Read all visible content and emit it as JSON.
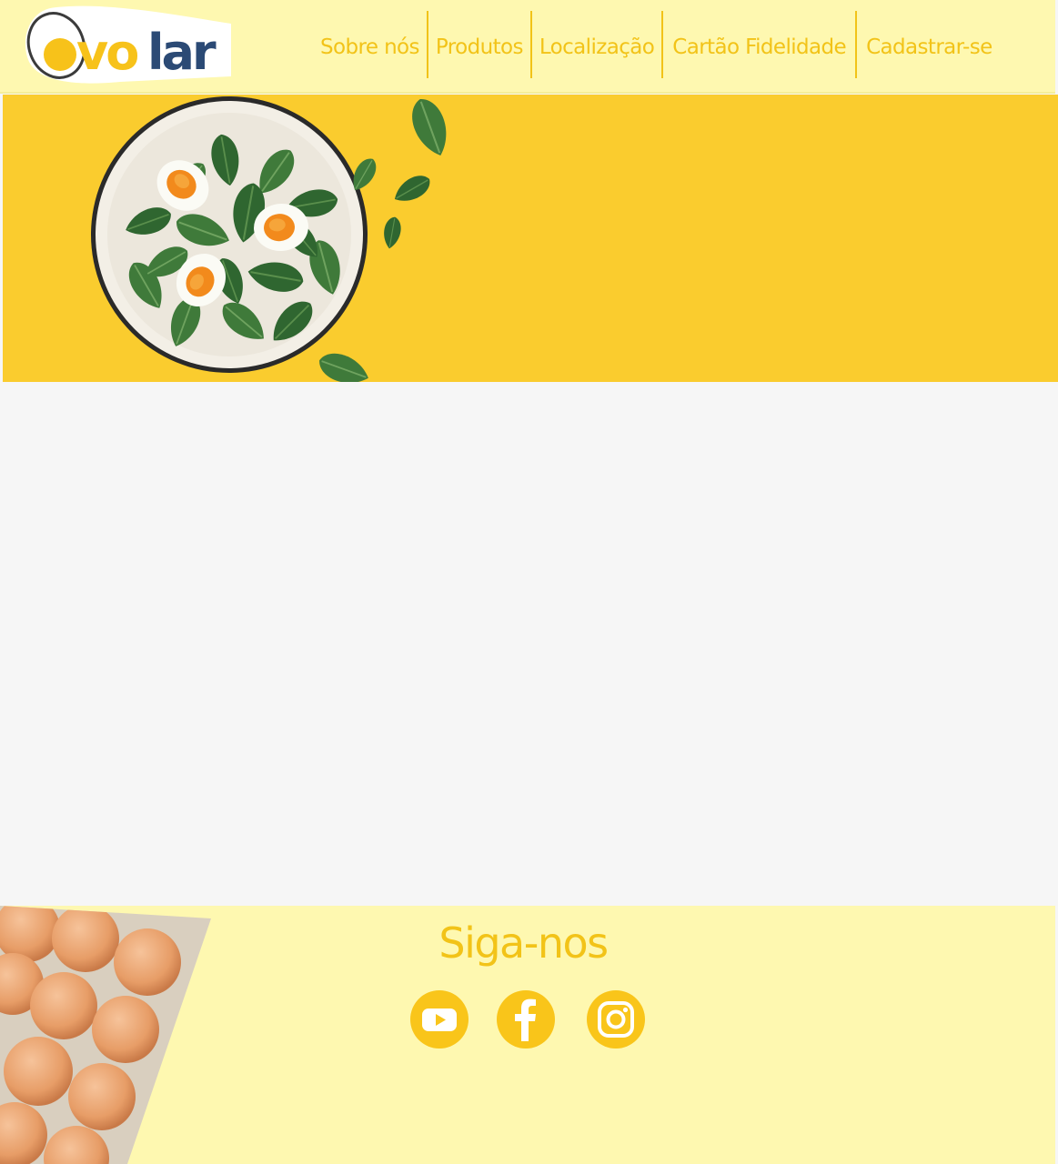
{
  "brand": {
    "logo_text": "ovolar",
    "colors": {
      "yellow": "#facc2e",
      "nav_text": "#f2c318",
      "pale_yellow": "#fef8b0",
      "logo_navy": "#2b4a75"
    }
  },
  "nav": {
    "items": [
      {
        "label": "Sobre nós"
      },
      {
        "label": "Produtos"
      },
      {
        "label": "Localização"
      },
      {
        "label": "Cartão Fidelidade"
      },
      {
        "label": "Cadastrar-se"
      }
    ]
  },
  "hero": {
    "image": "salad-bowl-with-eggs-and-spinach"
  },
  "footer": {
    "follow_title": "Siga-nos",
    "image": "egg-carton",
    "social": [
      {
        "icon": "youtube-icon"
      },
      {
        "icon": "facebook-icon"
      },
      {
        "icon": "instagram-icon"
      }
    ]
  }
}
